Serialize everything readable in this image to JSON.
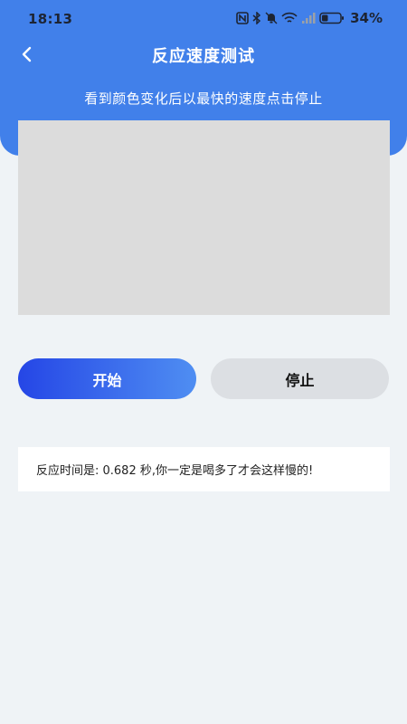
{
  "status_bar": {
    "time": "18:13",
    "battery_percent": "34%",
    "battery_level": 0.34,
    "icons": [
      "nfc-icon",
      "bluetooth-icon",
      "mute-icon",
      "wifi-icon",
      "signal-icon",
      "battery-icon"
    ]
  },
  "header": {
    "title": "反应速度测试",
    "back_icon": "chevron-left-icon",
    "instruction": "看到颜色变化后以最快的速度点击停止"
  },
  "test_area": {
    "color": "#dcdcdc"
  },
  "buttons": {
    "start_label": "开始",
    "stop_label": "停止"
  },
  "result": {
    "text": "反应时间是: 0.682 秒,你一定是喝多了才会这样慢的!"
  },
  "colors": {
    "header": "#4180ea",
    "start_gradient_from": "#2546e6",
    "start_gradient_to": "#4f8ef2",
    "stop_button": "#dcdfe3",
    "background": "#eff3f6"
  }
}
